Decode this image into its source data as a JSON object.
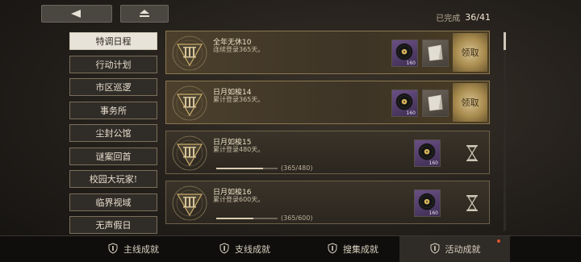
{
  "nav": {
    "back_icon": "back-arrow-icon",
    "home_icon": "home-icon"
  },
  "progress": {
    "label": "已完成",
    "value": "36/41"
  },
  "sidebar": {
    "items": [
      {
        "label": "特调日程",
        "active": true
      },
      {
        "label": "行动计划"
      },
      {
        "label": "市区巡逻"
      },
      {
        "label": "事务所"
      },
      {
        "label": "尘封公馆"
      },
      {
        "label": "谜案回首"
      },
      {
        "label": "校园大玩家!"
      },
      {
        "label": "临界视域"
      },
      {
        "label": "无声假日"
      }
    ]
  },
  "achievements": [
    {
      "title": "全年无休10",
      "desc": "连续登录365天。",
      "state": "claimable",
      "rewards": [
        {
          "icon": "vinyl-record-icon",
          "qty": "160",
          "color": "purple"
        },
        {
          "icon": "paper-document-icon",
          "qty": "",
          "color": "brown"
        }
      ],
      "action": "领取"
    },
    {
      "title": "日月如梭14",
      "desc": "累计登录365天。",
      "state": "claimable",
      "rewards": [
        {
          "icon": "vinyl-record-icon",
          "qty": "160",
          "color": "purple"
        },
        {
          "icon": "paper-document-icon",
          "qty": "",
          "color": "brown"
        }
      ],
      "action": "领取"
    },
    {
      "title": "日月如梭15",
      "desc": "累计登录480天。",
      "state": "pending",
      "progress_text": "(365/480)",
      "progress": 0.76,
      "rewards": [
        {
          "icon": "vinyl-record-icon",
          "qty": "160",
          "color": "purple"
        }
      ]
    },
    {
      "title": "日月如梭16",
      "desc": "累计登录600天。",
      "state": "pending",
      "progress_text": "(365/600)",
      "progress": 0.61,
      "rewards": [
        {
          "icon": "vinyl-record-icon",
          "qty": "160",
          "color": "purple"
        }
      ]
    }
  ],
  "bottom_tabs": [
    {
      "label": "主线成就",
      "icon": "shield-icon"
    },
    {
      "label": "支线成就",
      "icon": "card-icon"
    },
    {
      "label": "搜集成就",
      "icon": "winged-shield-icon"
    },
    {
      "label": "活动成就",
      "icon": "winged-star-icon",
      "active": true
    }
  ],
  "colors": {
    "accent": "#c9ab6a",
    "red_dot": "#e0542e"
  }
}
